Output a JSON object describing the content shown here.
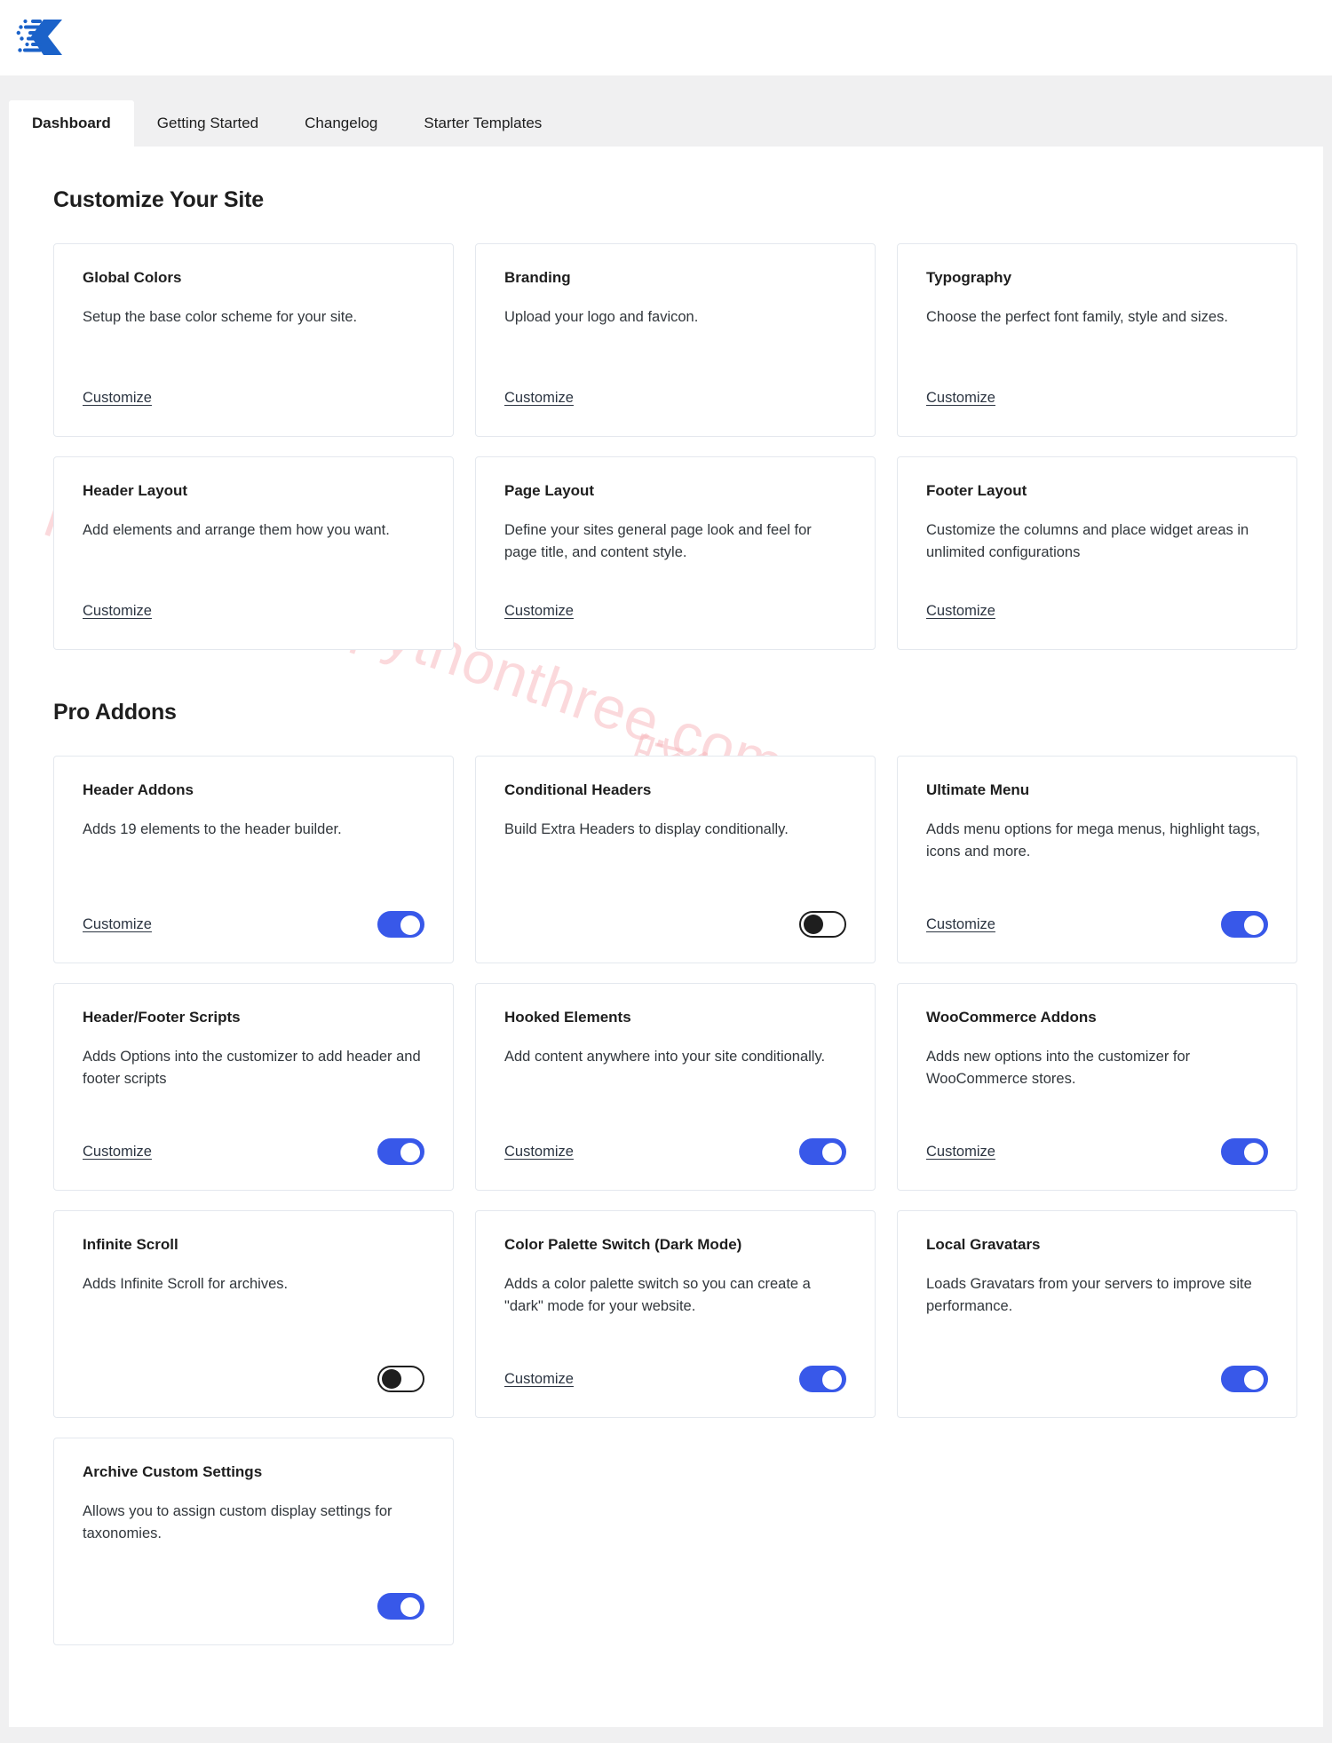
{
  "brand": {
    "logo_icon": "kadence-logo-icon",
    "accent_color": "#3858e9"
  },
  "tabs": [
    {
      "label": "Dashboard",
      "active": true
    },
    {
      "label": "Getting Started",
      "active": false
    },
    {
      "label": "Changelog",
      "active": false
    },
    {
      "label": "Starter Templates",
      "active": false
    }
  ],
  "sections": [
    {
      "title": "Customize Your Site",
      "cards": [
        {
          "title": "Global Colors",
          "desc": "Setup the base color scheme for your site.",
          "link": "Customize",
          "toggle": null
        },
        {
          "title": "Branding",
          "desc": "Upload your logo and favicon.",
          "link": "Customize",
          "toggle": null
        },
        {
          "title": "Typography",
          "desc": "Choose the perfect font family, style and sizes.",
          "link": "Customize",
          "toggle": null
        },
        {
          "title": "Header Layout",
          "desc": "Add elements and arrange them how you want.",
          "link": "Customize",
          "toggle": null
        },
        {
          "title": "Page Layout",
          "desc": "Define your sites general page look and feel for page title, and content style.",
          "link": "Customize",
          "toggle": null
        },
        {
          "title": "Footer Layout",
          "desc": "Customize the columns and place widget areas in unlimited configurations",
          "link": "Customize",
          "toggle": null
        }
      ]
    },
    {
      "title": "Pro Addons",
      "cards": [
        {
          "title": "Header Addons",
          "desc": "Adds 19 elements to the header builder.",
          "link": "Customize",
          "toggle": "on"
        },
        {
          "title": "Conditional Headers",
          "desc": "Build Extra Headers to display conditionally.",
          "link": "",
          "toggle": "off"
        },
        {
          "title": "Ultimate Menu",
          "desc": "Adds menu options for mega menus, highlight tags, icons and more.",
          "link": "Customize",
          "toggle": "on"
        },
        {
          "title": "Header/Footer Scripts",
          "desc": "Adds Options into the customizer to add header and footer scripts",
          "link": "Customize",
          "toggle": "on"
        },
        {
          "title": "Hooked Elements",
          "desc": "Add content anywhere into your site conditionally.",
          "link": "Customize",
          "toggle": "on"
        },
        {
          "title": "WooCommerce Addons",
          "desc": "Adds new options into the customizer for WooCommerce stores.",
          "link": "Customize",
          "toggle": "on"
        },
        {
          "title": "Infinite Scroll",
          "desc": "Adds Infinite Scroll for archives.",
          "link": "",
          "toggle": "off"
        },
        {
          "title": "Color Palette Switch (Dark Mode)",
          "desc": "Adds a color palette switch so you can create a \"dark\" mode for your website.",
          "link": "Customize",
          "toggle": "on"
        },
        {
          "title": "Local Gravatars",
          "desc": "Loads Gravatars from your servers to improve site performance.",
          "link": "",
          "toggle": "on"
        },
        {
          "title": "Archive Custom Settings",
          "desc": "Allows you to assign custom display settings for taxonomies.",
          "link": "",
          "toggle": "on"
        }
      ]
    }
  ],
  "watermark": {
    "url": "https://www.pythonthree.com",
    "text_cn": "晓得博客"
  }
}
